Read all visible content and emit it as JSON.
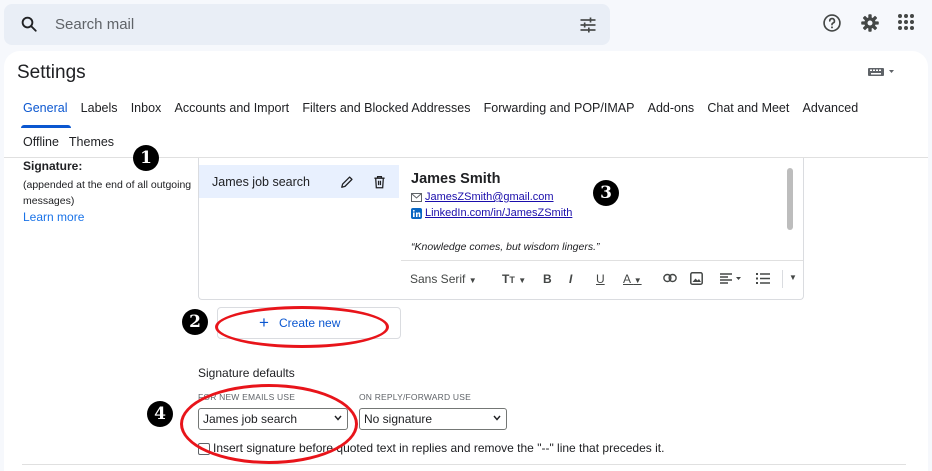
{
  "search": {
    "placeholder": "Search mail"
  },
  "settings": {
    "title": "Settings"
  },
  "tabs_row1": [
    "General",
    "Labels",
    "Inbox",
    "Accounts and Import",
    "Filters and Blocked Addresses",
    "Forwarding and POP/IMAP",
    "Add-ons",
    "Chat and Meet",
    "Advanced"
  ],
  "tabs_row2": [
    "Offline",
    "Themes"
  ],
  "signature": {
    "label": "Signature:",
    "description": "(appended at the end of all outgoing messages)",
    "learn_more": "Learn more",
    "items": [
      {
        "name": "James job search"
      }
    ]
  },
  "editor": {
    "name": "James Smith",
    "email": "JamesZSmith@gmail.com",
    "linkedin": "LinkedIn.com/in/JamesZSmith",
    "quote": "“Knowledge comes, but wisdom lingers.”",
    "font": "Sans Serif"
  },
  "create_new": {
    "label": "Create new"
  },
  "defaults": {
    "title": "Signature defaults",
    "new_caption": "FOR NEW EMAILS USE",
    "new_value": "James job search",
    "reply_caption": "ON REPLY/FORWARD USE",
    "reply_value": "No signature",
    "checkbox_label": "Insert signature before quoted text in replies and remove the \"--\" line that precedes it."
  },
  "annotations": {
    "one": "1",
    "two": "2",
    "three": "3",
    "four": "4"
  },
  "colors": {
    "accent": "#0b57d0",
    "annotation_ring": "#e8141a",
    "active_row": "#e8f0fe"
  },
  "icons": [
    "search-icon",
    "tune-icon",
    "help-icon",
    "gear-icon",
    "apps-icon",
    "keyboard-icon",
    "pencil-icon",
    "trash-icon",
    "mail-icon",
    "linkedin-icon"
  ]
}
